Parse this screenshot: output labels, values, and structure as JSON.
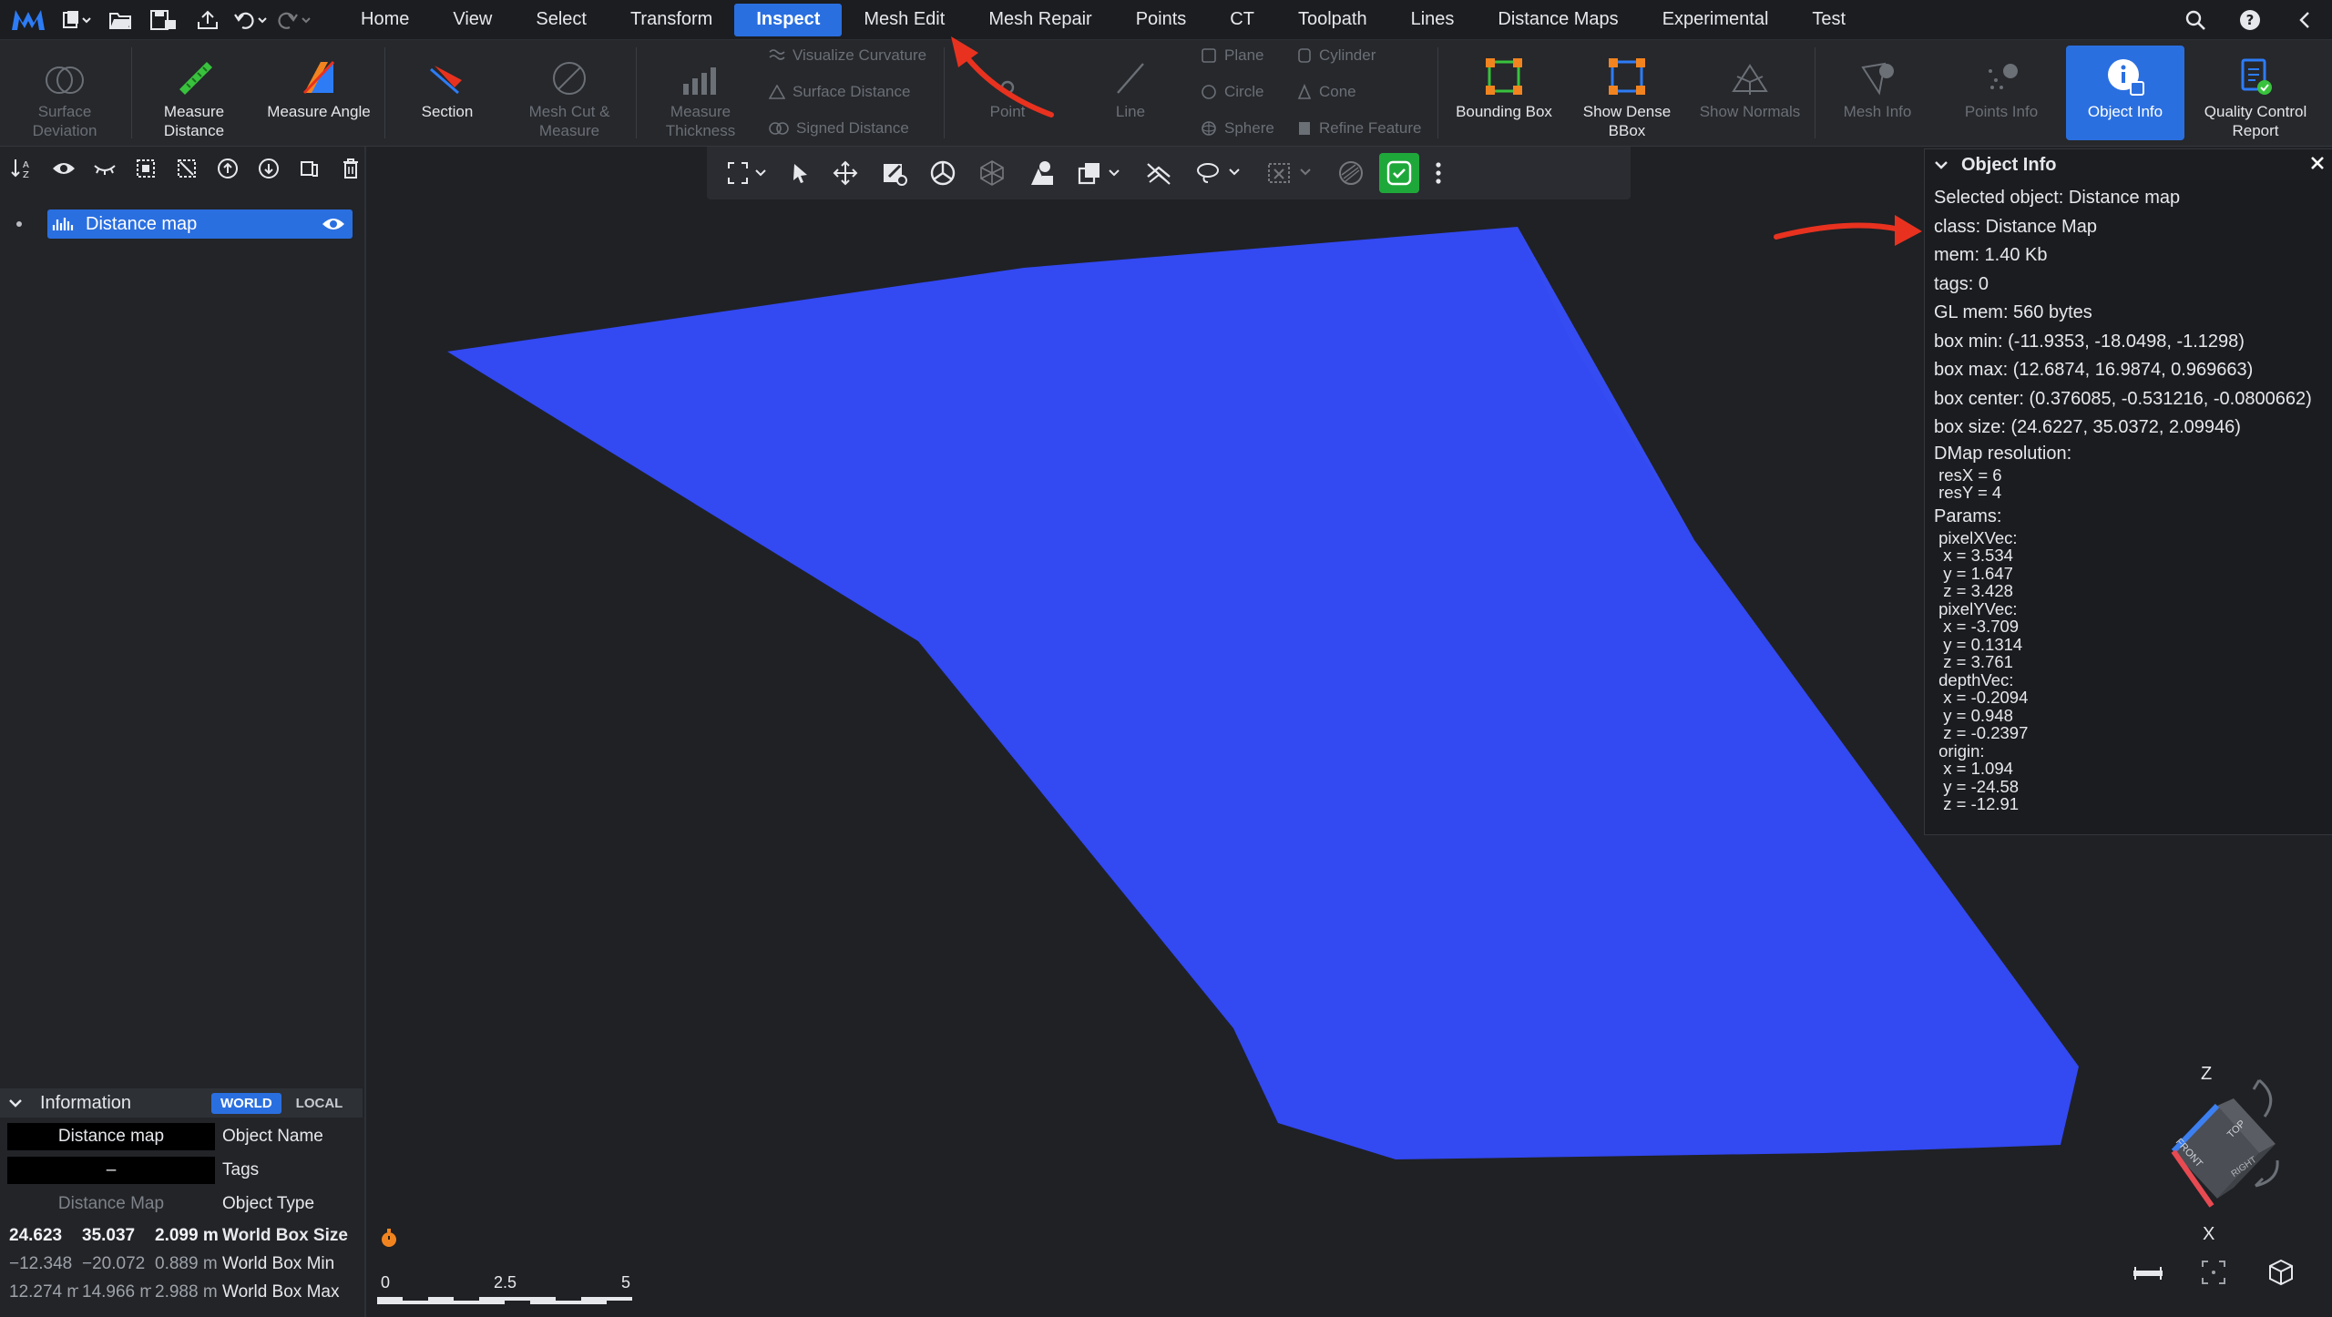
{
  "menubar": {
    "items": [
      "Home",
      "View",
      "Select",
      "Transform",
      "Inspect",
      "Mesh Edit",
      "Mesh Repair",
      "Points",
      "CT",
      "Toolpath",
      "Lines",
      "Distance Maps",
      "Experimental",
      "Test"
    ],
    "active_index": 4
  },
  "ribbon": {
    "surface_deviation": "Surface Deviation",
    "measure_distance": "Measure Distance",
    "measure_angle": "Measure Angle",
    "section": "Section",
    "mesh_cut_measure": "Mesh Cut & Measure",
    "measure_thickness": "Measure Thickness",
    "visualize_curvature": "Visualize Curvature",
    "surface_distance": "Surface Distance",
    "signed_distance": "Signed Distance",
    "point": "Point",
    "line": "Line",
    "plane": "Plane",
    "circle": "Circle",
    "sphere": "Sphere",
    "cylinder": "Cylinder",
    "cone": "Cone",
    "refine_feature": "Refine Feature",
    "bounding_box": "Bounding Box",
    "show_dense_bbox": "Show Dense BBox",
    "show_normals": "Show Normals",
    "mesh_info": "Mesh Info",
    "points_info": "Points Info",
    "object_info": "Object Info",
    "quality_control_report": "Quality Control Report"
  },
  "scene": {
    "items": [
      {
        "label": "Distance map"
      }
    ]
  },
  "info": {
    "title": "Information",
    "world": "WORLD",
    "local": "LOCAL",
    "object_name_value": "Distance map",
    "object_name_label": "Object Name",
    "tags_value": "–",
    "tags_label": "Tags",
    "object_type_value": "Distance Map",
    "object_type_label": "Object Type",
    "size": [
      "24.623",
      "35.037",
      "2.099 m"
    ],
    "size_label": "World Box Size",
    "min": [
      "−12.348",
      "−20.072",
      "0.889 m"
    ],
    "min_label": "World Box Min",
    "max": [
      "12.274 m",
      "14.966 m",
      "2.988 m"
    ],
    "max_label": "World Box Max"
  },
  "scalebar": {
    "labels": [
      "0",
      "2.5",
      "5"
    ]
  },
  "object_info": {
    "title": "Object Info",
    "selected": "Selected object: Distance map",
    "class": "class: Distance Map",
    "mem": "mem: 1.40 Kb",
    "tags": "tags: 0",
    "gl_mem": "GL mem: 560 bytes",
    "box_min": "box min: (-11.9353, -18.0498, -1.1298)",
    "box_max": "box max: (12.6874, 16.9874, 0.969663)",
    "box_center": "box center: (0.376085, -0.531216, -0.0800662)",
    "box_size": "box size: (24.6227, 35.0372, 2.09946)",
    "dmap_resolution": "DMap resolution:",
    "resX": " resX = 6",
    "resY": " resY = 4",
    "params": "Params:",
    "pixelXVec": " pixelXVec:",
    "pxx": "  x = 3.534",
    "pxy": "  y = 1.647",
    "pxz": "  z = 3.428",
    "pixelYVec": " pixelYVec:",
    "pyx": "  x = -3.709",
    "pyy": "  y = 0.1314",
    "pyz": "  z = 3.761",
    "depthVec": " depthVec:",
    "dx": "  x = -0.2094",
    "dy": "  y = 0.948",
    "dz": "  z = -0.2397",
    "origin": " origin:",
    "ox": "  x = 1.094",
    "oy": "  y = -24.58",
    "oz": "  z = -12.91"
  },
  "view_cube": {
    "axis_z": "Z",
    "axis_x": "X",
    "front": "FRONT",
    "top": "TOP",
    "right": "RIGHT"
  },
  "colors": {
    "accent": "#2a6fe0",
    "surface": "#3349f2",
    "annotation": "#e8321f"
  }
}
